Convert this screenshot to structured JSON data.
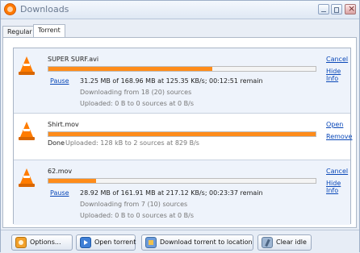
{
  "window": {
    "title": "Downloads",
    "tabs": [
      "Regular",
      "Torrent"
    ]
  },
  "downloads": [
    {
      "name": "SUPER SURF.avi",
      "progress_percent": 61.2,
      "pause_label": "Pause",
      "status_line": "31.25 MB of 168.96 MB at 125.35 KB/s; 00:12:51 remain",
      "sources_line": "Downloading from 18 (20) sources",
      "uploaded_line": "Uploaded: 0 B to 0 sources at 0 B/s",
      "actions": [
        "Cancel",
        "Hide Info"
      ]
    },
    {
      "name": "Shirt.mov",
      "progress_percent": 100,
      "done_label": "Done",
      "uploaded_line": "Uploaded: 128 kB to 2 sources at 829 B/s",
      "actions": [
        "Open",
        "Remove"
      ]
    },
    {
      "name": "62.mov",
      "progress_percent": 17.9,
      "pause_label": "Pause",
      "status_line": "28.92 MB of 161.91 MB at 217.12 KB/s; 00:23:37 remain",
      "sources_line": "Downloading from 7 (10) sources",
      "uploaded_line": "Uploaded: 0 B to 0 sources at 0 B/s",
      "actions": [
        "Cancel",
        "Hide Info"
      ]
    }
  ],
  "footer": {
    "options": "Options...",
    "open_torrent": "Open torrent",
    "download_to_location": "Download torrent to location",
    "clear_idle": "Clear idle"
  },
  "colors": {
    "accent": "#ff8c1a",
    "link": "#0a48b8"
  },
  "icons": {
    "app": "downloads-app-icon",
    "file": "vlc-cone-icon",
    "options": "options-icon",
    "open": "open-torrent-icon",
    "download": "download-location-icon",
    "clear": "clear-idle-icon"
  }
}
